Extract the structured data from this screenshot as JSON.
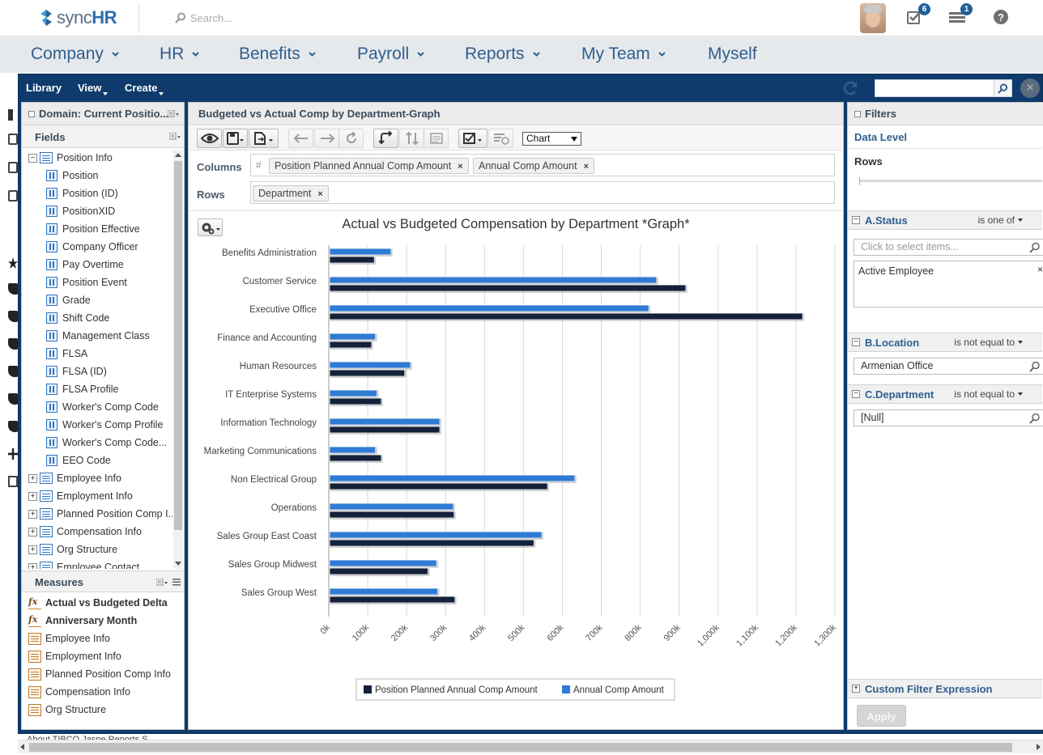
{
  "header": {
    "logo_text_1": "sync",
    "logo_text_2": "HR",
    "search_placeholder": "Search...",
    "tasks_badge": "6",
    "notifications_badge": "1",
    "help_icon": "help-icon"
  },
  "nav": {
    "items": [
      {
        "label": "Company",
        "has_menu": true
      },
      {
        "label": "HR",
        "has_menu": true
      },
      {
        "label": "Benefits",
        "has_menu": true
      },
      {
        "label": "Payroll",
        "has_menu": true
      },
      {
        "label": "Reports",
        "has_menu": true
      },
      {
        "label": "My Team",
        "has_menu": true
      },
      {
        "label": "Myself",
        "has_menu": false
      }
    ]
  },
  "frame_menu": {
    "library": "Library",
    "view": "View",
    "create": "Create"
  },
  "left_panel": {
    "title": "Domain: Current Positio...",
    "fields_label": "Fields",
    "measures_label": "Measures",
    "fields": [
      {
        "label": "Position Info",
        "kind": "folder-open"
      },
      {
        "label": "Position",
        "kind": "field"
      },
      {
        "label": "Position (ID)",
        "kind": "field"
      },
      {
        "label": "PositionXID",
        "kind": "field"
      },
      {
        "label": "Position Effective",
        "kind": "field"
      },
      {
        "label": "Company Officer",
        "kind": "field"
      },
      {
        "label": "Pay Overtime",
        "kind": "field"
      },
      {
        "label": "Position Event",
        "kind": "field"
      },
      {
        "label": "Grade",
        "kind": "field"
      },
      {
        "label": "Shift Code",
        "kind": "field"
      },
      {
        "label": "Management Class",
        "kind": "field"
      },
      {
        "label": "FLSA",
        "kind": "field"
      },
      {
        "label": "FLSA (ID)",
        "kind": "field"
      },
      {
        "label": "FLSA Profile",
        "kind": "field"
      },
      {
        "label": "Worker's Comp Code",
        "kind": "field"
      },
      {
        "label": "Worker's Comp Profile",
        "kind": "field"
      },
      {
        "label": "Worker's Comp Code...",
        "kind": "field"
      },
      {
        "label": "EEO Code",
        "kind": "field"
      },
      {
        "label": "Employee Info",
        "kind": "folder"
      },
      {
        "label": "Employment Info",
        "kind": "folder"
      },
      {
        "label": "Planned Position Comp I...",
        "kind": "folder"
      },
      {
        "label": "Compensation Info",
        "kind": "folder"
      },
      {
        "label": "Org Structure",
        "kind": "folder"
      },
      {
        "label": "Employee Contact",
        "kind": "folder"
      }
    ],
    "measures": [
      {
        "label": "Actual vs Budgeted Delta",
        "kind": "calc"
      },
      {
        "label": "Anniversary Month",
        "kind": "calc"
      },
      {
        "label": "Employee Info",
        "kind": "folder"
      },
      {
        "label": "Employment Info",
        "kind": "folder"
      },
      {
        "label": "Planned Position Comp Info",
        "kind": "folder"
      },
      {
        "label": "Compensation Info",
        "kind": "folder"
      },
      {
        "label": "Org Structure",
        "kind": "folder"
      }
    ]
  },
  "center_panel": {
    "title": "Budgeted vs Actual Comp by Department-Graph",
    "view_select": "Chart",
    "columns_label": "Columns",
    "rows_label": "Rows",
    "columns_hash": "#",
    "columns": [
      "Position Planned Annual Comp Amount",
      "Annual Comp Amount"
    ],
    "rows": [
      "Department"
    ]
  },
  "right_panel": {
    "title": "Filters",
    "data_level": "Data Level",
    "rows_label": "Rows",
    "filters": [
      {
        "name": "A.Status",
        "op": "is one of",
        "placeholder": "Click to select items...",
        "values": [
          "Active Employee"
        ]
      },
      {
        "name": "B.Location",
        "op": "is not equal to",
        "value": "Armenian Office"
      },
      {
        "name": "C.Department",
        "op": "is not equal to",
        "value": "[Null]"
      }
    ],
    "custom_filter": "Custom Filter Expression",
    "apply": "Apply"
  },
  "bottom": {
    "under_text": "About TIBCO Jaspe Reports S..."
  },
  "colors": {
    "navy": "#0e3b6b",
    "budget_series": "#14213a",
    "actual_series": "#2f7bd3",
    "nav_text": "#2d5f8f"
  },
  "chart_data": {
    "type": "bar",
    "orientation": "horizontal",
    "title": "Actual vs Budgeted Compensation by Department *Graph*",
    "categories": [
      "Benefits Administration",
      "Customer Service",
      "Executive Office",
      "Finance and Accounting",
      "Human Resources",
      "IT Enterprise Systems",
      "Information Technology",
      "Marketing Communications",
      "Non Electrical Group",
      "Operations",
      "Sales Group East Coast",
      "Sales Group Midwest",
      "Sales Group West"
    ],
    "series": [
      {
        "name": "Position Planned Annual Comp Amount",
        "color": "#14213a",
        "values": [
          115000,
          915000,
          1215000,
          108000,
          193000,
          133000,
          283000,
          133000,
          560000,
          320000,
          525000,
          253000,
          322000
        ]
      },
      {
        "name": "Annual Comp Amount",
        "color": "#2f7bd3",
        "values": [
          158000,
          840000,
          820000,
          118000,
          208000,
          122000,
          283000,
          118000,
          630000,
          318000,
          545000,
          275000,
          278000
        ]
      }
    ],
    "xlim": [
      0,
      1300000
    ],
    "x_ticks": [
      "0k",
      "100k",
      "200k",
      "300k",
      "400k",
      "500k",
      "600k",
      "700k",
      "800k",
      "900k",
      "1,000k",
      "1,100k",
      "1,200k",
      "1,300k"
    ],
    "grid": true,
    "legend": "bottom-center"
  }
}
